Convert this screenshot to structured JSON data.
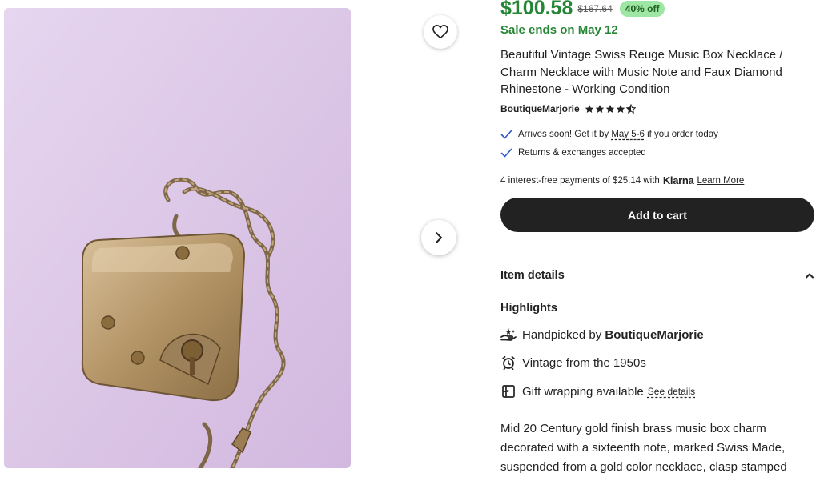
{
  "listing": {
    "price": "$100.58",
    "original_price": "$167.64",
    "discount": "40% off",
    "sale_ends": "Sale ends on May 12",
    "title": "Beautiful Vintage Swiss Reuge Music Box Necklace / Charm Necklace with Music Note and Faux Diamond Rhinestone - Working Condition",
    "shop_name": "BoutiqueMarjorie",
    "rating": 4.5,
    "image_alt": "Vintage brass music box charm on a gold chain"
  },
  "shipping": {
    "arrives_prefix": "Arrives soon! Get it by",
    "arrives_dates": "May 5-6",
    "arrives_suffix": "if you order today",
    "returns": "Returns & exchanges accepted"
  },
  "klarna": {
    "text": "4 interest-free payments of $25.14 with",
    "logo": "Klarna",
    "learn_more": "Learn More"
  },
  "actions": {
    "add_to_cart": "Add to cart",
    "favorite_icon": "heart-icon",
    "next_icon": "chevron-right-icon"
  },
  "item_details": {
    "header": "Item details",
    "highlights_title": "Highlights",
    "handpicked_prefix": "Handpicked by",
    "handpicked_shop": "BoutiqueMarjorie",
    "vintage": "Vintage from the 1950s",
    "gift": "Gift wrapping available",
    "see_details": "See details",
    "description": "Mid 20 Century gold finish brass music box charm decorated with a sixteenth note, marked Swiss Made, suspended from a gold color necklace, clasp stamped"
  },
  "colors": {
    "sale_green": "#258635",
    "discount_bg": "#9ee6a3",
    "button_dark": "#222222",
    "check_blue": "#2b57c9"
  }
}
